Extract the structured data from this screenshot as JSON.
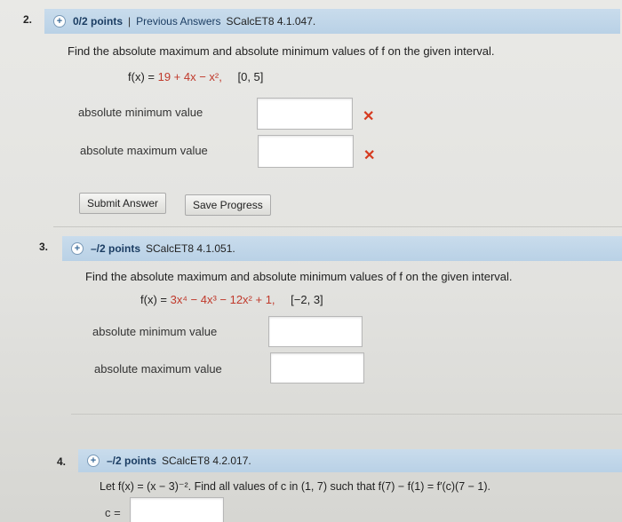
{
  "problems": [
    {
      "number": "2.",
      "points": "0/2 points",
      "separator": "|",
      "previous_answers": "Previous Answers",
      "code": "SCalcET8 4.1.047.",
      "question": "Find the absolute maximum and absolute minimum values of f on the given interval.",
      "formula_prefix": "f(x) = ",
      "formula_expr": "19 + 4x − x²,",
      "interval": "[0, 5]",
      "min_label": "absolute minimum value",
      "max_label": "absolute maximum value",
      "submit_label": "Submit Answer",
      "save_label": "Save Progress"
    },
    {
      "number": "3.",
      "points": "–/2 points",
      "code": "SCalcET8 4.1.051.",
      "question": "Find the absolute maximum and absolute minimum values of f on the given interval.",
      "formula_prefix": "f(x) = ",
      "formula_expr": "3x⁴ − 4x³ − 12x² + 1,",
      "interval": "[−2, 3]",
      "min_label": "absolute minimum value",
      "max_label": "absolute maximum value"
    },
    {
      "number": "4.",
      "points": "–/2 points",
      "code": "SCalcET8 4.2.017.",
      "question": "Let f(x) = (x − 3)⁻². Find all values of c in (1, 7) such that f(7) − f(1) = f′(c)(7 − 1).",
      "c_label": "c ="
    }
  ],
  "status_colors": {
    "incorrect": "#d63a1f",
    "header_bar": "#c2d7ea"
  },
  "icons": {
    "expand": "plus-circle-icon",
    "wrong": "x-mark-icon"
  },
  "marks": {
    "wrong": "✕"
  }
}
